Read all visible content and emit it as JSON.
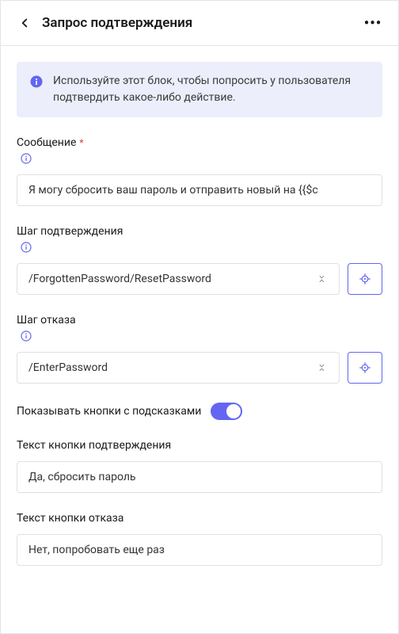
{
  "header": {
    "title": "Запрос подтверждения"
  },
  "info": {
    "text": "Используйте этот блок, чтобы попросить у пользователя подтвердить какое-либо действие."
  },
  "message": {
    "label": "Сообщение",
    "value": "Я могу сбросить ваш пароль и отправить новый на {{$c"
  },
  "confirmStep": {
    "label": "Шаг подтверждения",
    "value": "/ForgottenPassword/ResetPassword"
  },
  "denyStep": {
    "label": "Шаг отказа",
    "value": "/EnterPassword"
  },
  "showHints": {
    "label": "Показывать кнопки с подсказками",
    "enabled": true
  },
  "confirmButtonText": {
    "label": "Текст кнопки подтверждения",
    "value": "Да, сбросить пароль"
  },
  "denyButtonText": {
    "label": "Текст кнопки отказа",
    "value": "Нет, попробовать еще раз"
  }
}
